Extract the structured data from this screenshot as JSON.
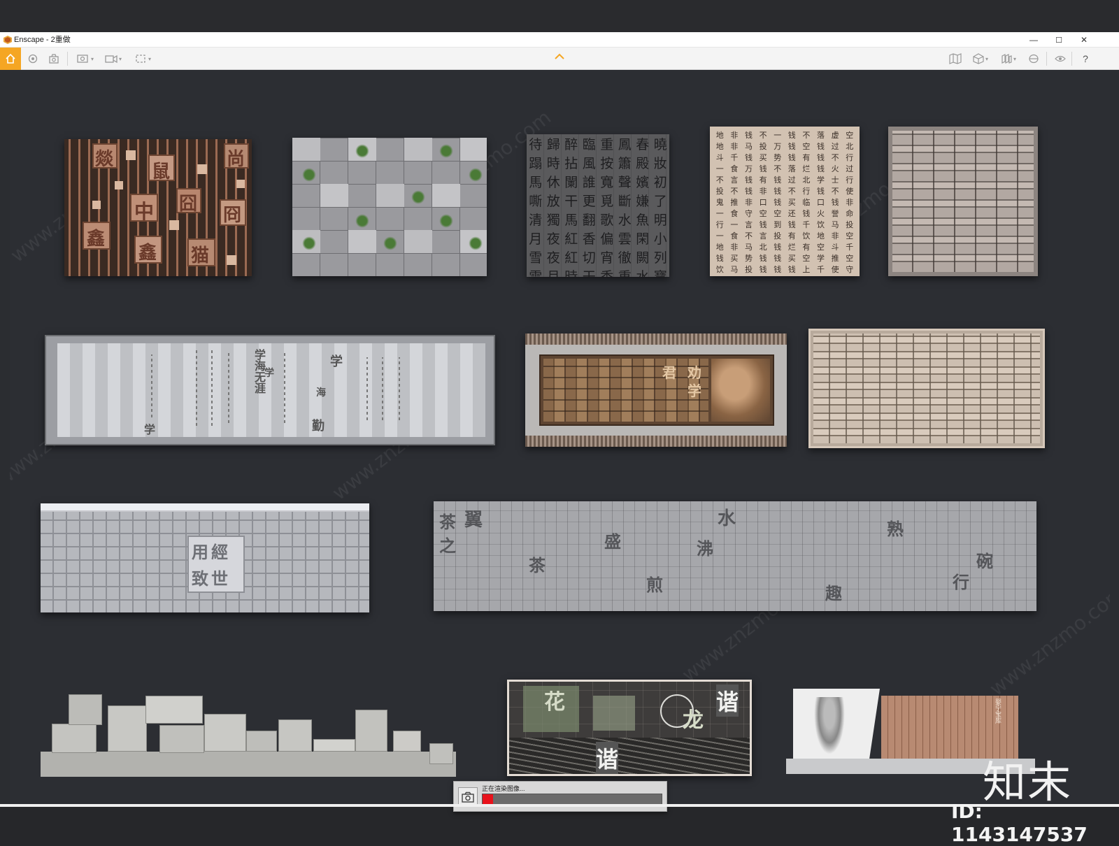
{
  "window": {
    "title": "Enscape - 2重做",
    "controls": {
      "minimize": "—",
      "maximize": "☐",
      "close": "✕"
    }
  },
  "toolbar": {
    "left_icons": [
      "home-icon",
      "orbit-icon",
      "render-icon",
      "screenshot-icon",
      "video-icon",
      "batch-icon"
    ],
    "right_icons": [
      "map-icon",
      "cube-icon",
      "asset-library-icon",
      "vr-icon",
      "visibility-icon",
      "help-icon"
    ],
    "help_label": "?",
    "accent_color": "#f5a623"
  },
  "panels": {
    "p1_chars": [
      "燚",
      "鼠",
      "中",
      "囧",
      "尚",
      "冏",
      "鑫",
      "鑫",
      "猫"
    ],
    "p3_chars": "待歸醉臨重鳳春曉蹋時拈風按簫殿妝馬休闌誰寬聲嬪初嘶放干更覓斷嫌了清獨馬翻歌水魚明月夜紅香偏雲閑小雪夜紅切宵徹闕列雪月時干香重水寶了",
    "p4_chars": "地非钱不一钱不落虚空地非马投万钱空钱过北斗千钱买势钱有钱不行一食万钱不落烂钱火过不言钱有钱过北学士行投不钱非钱不行钱不使鬼推非口钱买临口钱非一食守空空还钱火誉命行一言钱到钱千饮马投一食不言投有饮地非空地非马北钱烂有空斗千钱买势钱钱买空学推空饮马投钱钱钱上千使守钱钱有势钱地投地非钱",
    "scroll_chars": [
      "学",
      "学",
      "海",
      "勤",
      "学",
      "学海无涯"
    ],
    "mural_chars": [
      "君",
      "劝",
      "学"
    ],
    "seal_chars": [
      "經",
      "世",
      "致",
      "用"
    ],
    "tea_chars": [
      "茶",
      "翼",
      "盛",
      "水",
      "沸",
      "熟",
      "碗",
      "之",
      "茶",
      "煎",
      "行",
      "趣"
    ],
    "harmony_chars": [
      "花",
      "谐",
      "龙",
      "谐"
    ],
    "book_label": "婴宁宝库"
  },
  "render_status": {
    "message": "正在渲染图像...",
    "progress": 0.06
  },
  "watermark": {
    "logo_text": "知末",
    "id_text": "ID: 1143147537",
    "bg_text": "www.znzmo.com"
  }
}
